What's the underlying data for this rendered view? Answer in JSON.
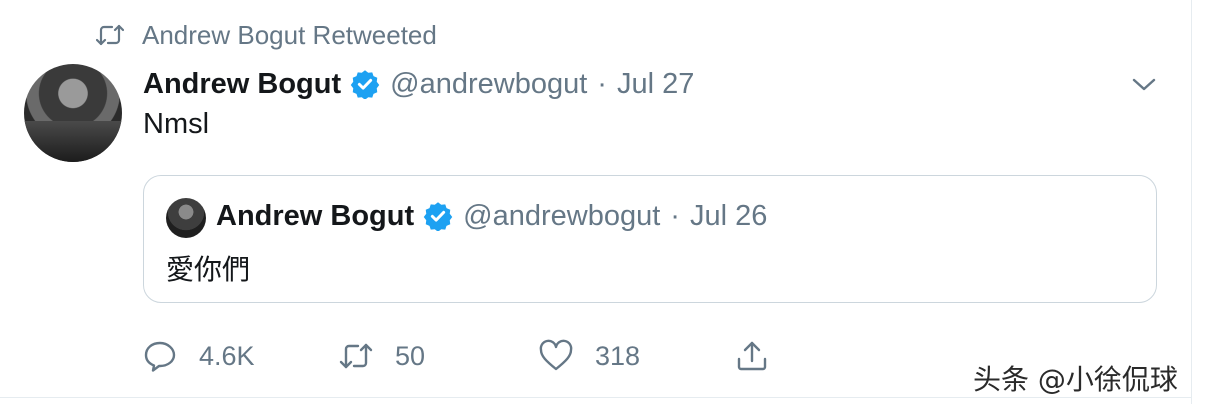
{
  "retweet_banner": {
    "text": "Andrew Bogut Retweeted",
    "icon": "retweet-icon"
  },
  "tweet": {
    "author_name": "Andrew Bogut",
    "handle": "@andrewbogut",
    "separator": "·",
    "date": "Jul 27",
    "text": "Nmsl",
    "verified": true
  },
  "quoted_tweet": {
    "author_name": "Andrew Bogut",
    "handle": "@andrewbogut",
    "separator": "·",
    "date": "Jul 26",
    "text": "愛你們",
    "verified": true
  },
  "actions": {
    "reply": {
      "icon": "reply-icon",
      "count": "4.6K"
    },
    "retweet": {
      "icon": "retweet-icon",
      "count": "50"
    },
    "like": {
      "icon": "heart-icon",
      "count": "318"
    },
    "share": {
      "icon": "share-icon"
    }
  },
  "watermark": "头条 @小徐侃球",
  "colors": {
    "text": "#14171a",
    "muted": "#657786",
    "verified": "#1da1f2",
    "border": "#ccd6dd"
  }
}
